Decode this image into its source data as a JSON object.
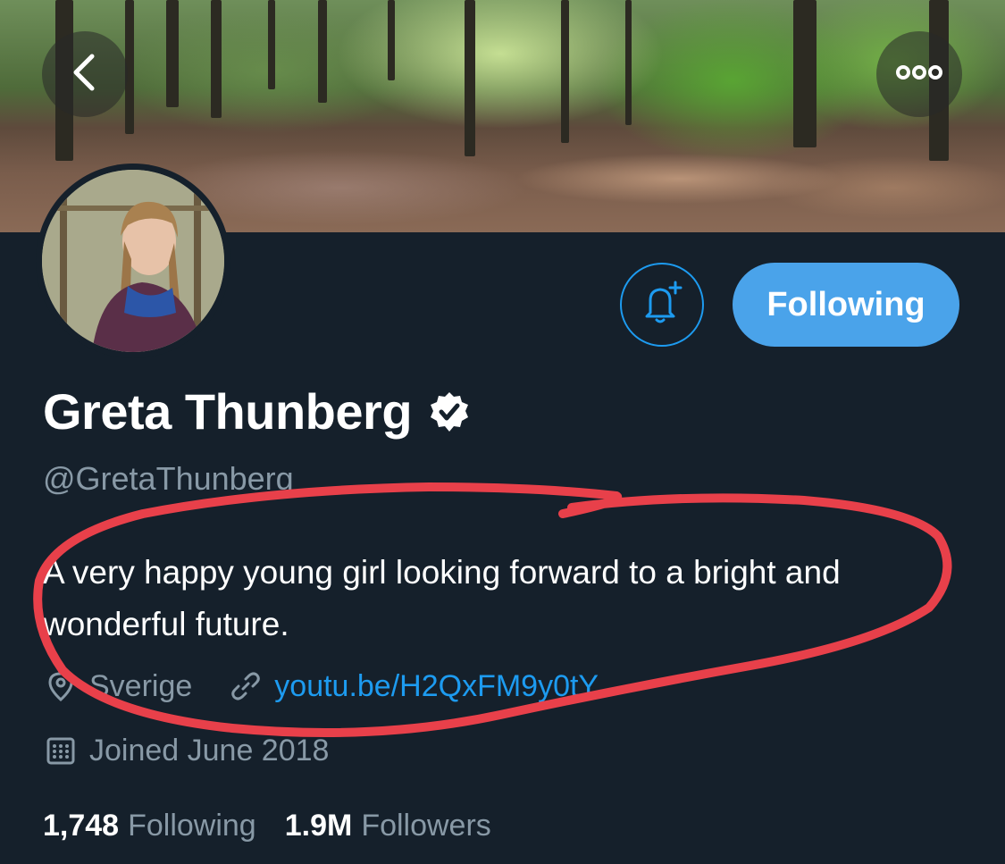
{
  "header": {
    "back_icon": "chevron-left-icon",
    "more_icon": "more-horizontal-icon"
  },
  "profile": {
    "display_name": "Greta Thunberg",
    "verified_icon": "verified-badge-icon",
    "handle": "@GretaThunberg",
    "bio": "A very happy young girl looking forward to a bright and wonderful future.",
    "location": "Sverige",
    "website": "youtu.be/H2QxFM9y0tY",
    "joined": "Joined June 2018"
  },
  "actions": {
    "notify_icon": "bell-plus-icon",
    "following_label": "Following"
  },
  "stats": {
    "following_count": "1,748",
    "following_label": "Following",
    "followers_count": "1.9M",
    "followers_label": "Followers"
  },
  "colors": {
    "background": "#15202b",
    "accent": "#1d9bf0",
    "button": "#4aa3ea",
    "secondary_text": "#8899a6",
    "annotation": "#e8404a"
  }
}
